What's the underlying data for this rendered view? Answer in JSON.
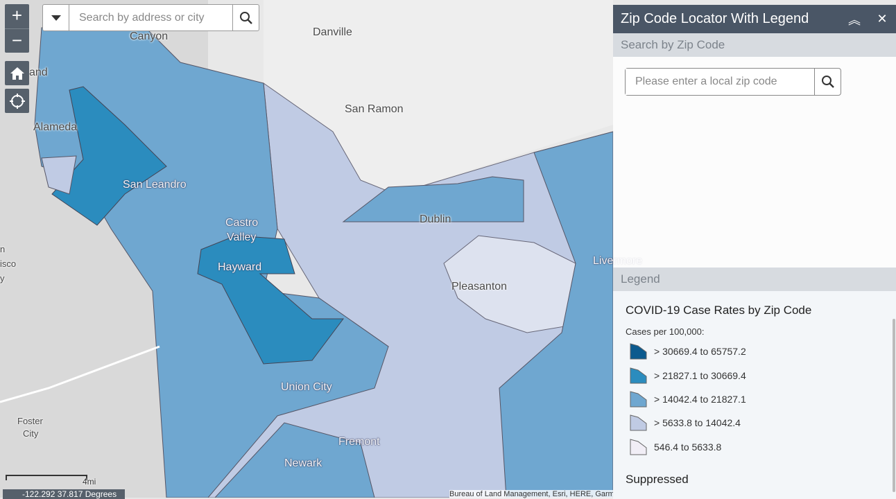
{
  "map": {
    "places": [
      "Canyon",
      "Danville",
      "San Ramon",
      "Alameda",
      "San Leandro",
      "Castro",
      "Valley",
      "Hayward",
      "Dublin",
      "Pleasanton",
      "Livermore",
      "Union City",
      "Fremont",
      "Newark",
      "Foster",
      "City",
      "and",
      "n",
      "isco",
      "y"
    ],
    "scale_label": "4mi",
    "coordinates": "-122.292 37.817 Degrees",
    "attribution": "Bureau of Land Management, Esri, HERE, Garmin, USGS, EPA, NPS | Esri, HERE, NPS",
    "search": {
      "placeholder": "Search by address or city"
    },
    "zoom_in": "+",
    "zoom_out": "−"
  },
  "panel": {
    "title": "Zip Code Locator With Legend",
    "search_section": "Search by Zip Code",
    "zip_placeholder": "Please enter a local zip code",
    "legend_section": "Legend",
    "legend": {
      "title": "COVID-19 Case Rates by Zip Code",
      "subtitle": "Cases per 100,000:",
      "classes": [
        {
          "label": "> 30669.4 to 65757.2",
          "color": "#0b5a8e"
        },
        {
          "label": "> 21827.1 to 30669.4",
          "color": "#2b8cbe"
        },
        {
          "label": "> 14042.4 to 21827.1",
          "color": "#6fa7d0"
        },
        {
          "label": "> 5633.8 to 14042.4",
          "color": "#c0cbe4"
        },
        {
          "label": "546.4 to 5633.8",
          "color": "#f1eef6"
        }
      ],
      "suppressed": "Suppressed"
    }
  }
}
